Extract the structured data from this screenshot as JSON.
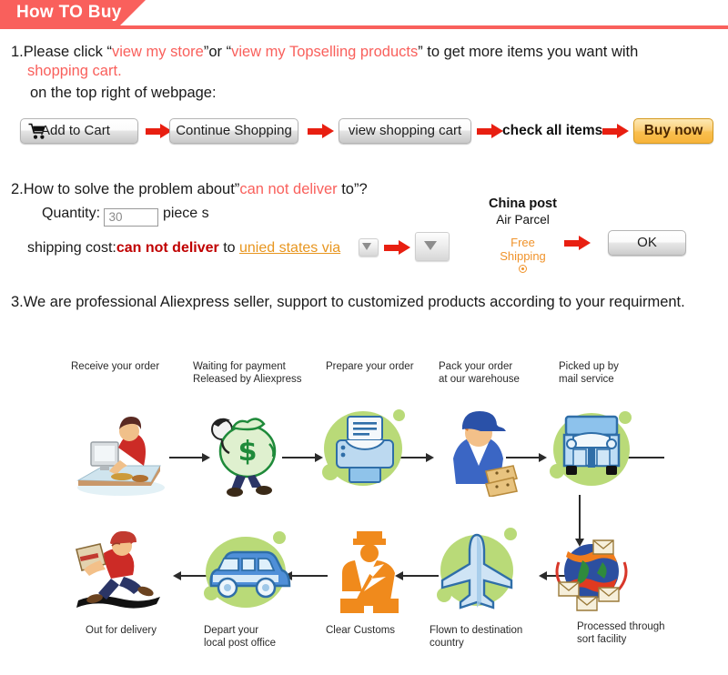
{
  "header": {
    "title": "How TO Buy",
    "accent": "#f9605c"
  },
  "step1": {
    "prefix": "1.Please click “",
    "link1": "view my store",
    "mid": "”or “",
    "link2": "view my Topselling products",
    "suffix": "” to get more items you want with",
    "line2": "shopping cart.",
    "line3": "on the top right of webpage:"
  },
  "buttons": {
    "add_to_cart": "Add to Cart",
    "cart_icon": "shopping-cart-icon",
    "continue_shopping": "Continue Shopping",
    "view_shopping_cart": "view shopping cart",
    "check_all_items": "check all items",
    "buy_now": "Buy now",
    "arrow_icon": "red-arrow-right-icon"
  },
  "step2": {
    "prefix": "2.How to solve the problem about”",
    "highlight": "can not deliver",
    "suffix": " to”?",
    "quantity_label": "Quantity:",
    "quantity_value": "30",
    "quantity_unit": "piece s",
    "shipping_label": "shipping cost:",
    "shipping_status": "can not deliver",
    "shipping_to": " to ",
    "destination": "unied states via",
    "dropdown_icon": "chevron-down-icon",
    "carrier_title": "China post",
    "carrier_sub": "Air Parcel",
    "free_shipping_line1": "Free",
    "free_shipping_line2": "Shipping",
    "radio_icon": "radio-selected-icon",
    "ok_button": "OK"
  },
  "step3": {
    "text": "3.We are professional Aliexpress seller, support to customized products according to your requirment."
  },
  "flow": {
    "top": [
      {
        "label": "Receive your order",
        "icon": "person-at-computer-icon"
      },
      {
        "label": "Waiting for payment\nReleased by Aliexpress",
        "icon": "money-bag-man-icon"
      },
      {
        "label": "Prepare your order",
        "icon": "printer-icon"
      },
      {
        "label": "Pack your order\nat our warehouse",
        "icon": "worker-with-boxes-icon"
      },
      {
        "label": "Picked up by\nmail service",
        "icon": "delivery-truck-icon"
      }
    ],
    "bottom": [
      {
        "label": "Out for delivery",
        "icon": "running-courier-icon"
      },
      {
        "label": "Depart your\nlocal post office",
        "icon": "delivery-van-icon"
      },
      {
        "label": "Clear Customs",
        "icon": "customs-officer-icon"
      },
      {
        "label": "Flown to destination\ncountry",
        "icon": "airplane-icon"
      },
      {
        "label": "Processed through\nsort facility",
        "icon": "globe-mail-sort-icon"
      }
    ]
  }
}
